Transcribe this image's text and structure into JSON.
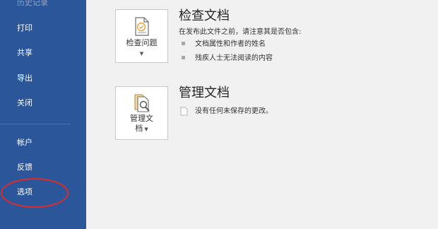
{
  "sidebar": {
    "items": [
      {
        "label": "历史记录"
      },
      {
        "label": "打印"
      },
      {
        "label": "共享"
      },
      {
        "label": "导出"
      },
      {
        "label": "关闭"
      },
      {
        "label": "帐户"
      },
      {
        "label": "反馈"
      },
      {
        "label": "选项"
      }
    ]
  },
  "inspect": {
    "button_label": "检查问题",
    "title": "检查文档",
    "description": "在发布此文件之前，请注意其是否包含:",
    "bullets": [
      "文档属性和作者的姓名",
      "残疾人士无法阅读的内容"
    ]
  },
  "manage": {
    "button_label_line1": "管理文",
    "button_label_line2": "档",
    "title": "管理文档",
    "status": "没有任何未保存的更改。"
  },
  "colors": {
    "sidebar_bg": "#2b579a",
    "highlight": "#e02a2a"
  },
  "icons": {
    "inspect": "document-check-icon",
    "manage": "document-search-icon",
    "caret": "caret-down-icon",
    "status": "document-page-icon"
  }
}
